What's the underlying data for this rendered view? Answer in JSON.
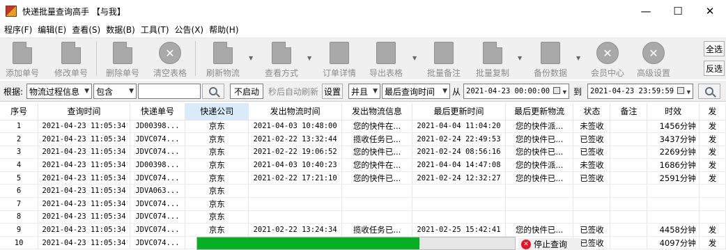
{
  "window": {
    "title": "快递批量查询高手 【与我】",
    "controls": {
      "minimize": "—",
      "maximize": "☐",
      "close": "✕"
    }
  },
  "menu": [
    "程序(F)",
    "编辑(E)",
    "查看(S)",
    "数据(B)",
    "工具(T)",
    "公告(X)",
    "帮助(H)"
  ],
  "toolbar": {
    "buttons": [
      {
        "label": "添加单号",
        "icon": "add-document-icon"
      },
      {
        "label": "修改单号",
        "icon": "edit-document-icon"
      },
      {
        "label": "删除单号",
        "icon": "delete-document-icon"
      },
      {
        "label": "清空表格",
        "icon": "clear-icon"
      },
      {
        "label": "刷新物流",
        "icon": "refresh-icon"
      },
      {
        "label": "查看方式",
        "icon": "view-mode-icon"
      },
      {
        "label": "订单详情",
        "icon": "order-detail-icon"
      },
      {
        "label": "导出表格",
        "icon": "export-icon"
      },
      {
        "label": "批量备注",
        "icon": "note-icon"
      },
      {
        "label": "批量复制",
        "icon": "copy-icon"
      },
      {
        "label": "备份数据",
        "icon": "backup-icon"
      },
      {
        "label": "会员中心",
        "icon": "clock-icon"
      },
      {
        "label": "高级设置",
        "icon": "gear-icon"
      }
    ],
    "select_all": "全选",
    "invert_select": "反选"
  },
  "filter": {
    "by_label": "根据:",
    "field": "物流过程信息",
    "operator": "包含",
    "keyword": "",
    "auto_refresh_toggle": "不启动",
    "auto_refresh_text": "秒后自动刷新",
    "settings": "设置",
    "logic": "并且",
    "time_field": "最后查询时间",
    "from_label": "从",
    "from_value": "2021-04-23 00:00:00",
    "to_label": "到",
    "to_value": "2021-04-23 23:59:59"
  },
  "table": {
    "columns": [
      "序号",
      "查询时间",
      "快递单号",
      "快递公司",
      "发出物流时间",
      "发出物流信息",
      "最后更新时间",
      "最后更新物流",
      "状态",
      "备注",
      "时效",
      "发"
    ],
    "rows": [
      [
        "1",
        "2021-04-23 11:05:34",
        "JD00398...",
        "京东",
        "2021-04-03 10:48:00",
        "您的快件在...",
        "2021-04-04 11:04:20",
        "您的快件派...",
        "未签收",
        "",
        "1456分钟",
        "发"
      ],
      [
        "2",
        "2021-04-23 11:05:34",
        "JDVC074...",
        "京东",
        "2021-02-22 13:32:44",
        "揽收任务已...",
        "2021-02-24 22:49:53",
        "您的快件已...",
        "已签收",
        "",
        "3437分钟",
        "发"
      ],
      [
        "3",
        "2021-04-23 11:05:34",
        "JDVC074...",
        "京东",
        "2021-02-22 19:06:52",
        "您的快件已...",
        "2021-02-24 08:56:16",
        "您的快件已...",
        "已签收",
        "",
        "2269分钟",
        "发"
      ],
      [
        "4",
        "2021-04-23 11:05:34",
        "JD00398...",
        "京东",
        "2021-04-03 10:40:23",
        "您的快件在...",
        "2021-04-04 14:47:08",
        "您的快件派...",
        "未签收",
        "",
        "1686分钟",
        "发"
      ],
      [
        "5",
        "2021-04-23 11:05:34",
        "JDVC074...",
        "京东",
        "2021-02-22 17:21:10",
        "您的快件已...",
        "2021-02-24 12:32:27",
        "您的快件已...",
        "已签收",
        "",
        "2591分钟",
        "发"
      ],
      [
        "6",
        "2021-04-23 11:05:34",
        "JDVA063...",
        "京东",
        "",
        "",
        "",
        "",
        "",
        "",
        "",
        ""
      ],
      [
        "7",
        "2021-04-23 11:05:34",
        "JDVC074...",
        "京东",
        "",
        "",
        "",
        "",
        "",
        "",
        "",
        ""
      ],
      [
        "8",
        "2021-04-23 11:05:34",
        "JDVC074...",
        "京东",
        "",
        "",
        "",
        "",
        "",
        "",
        "",
        ""
      ],
      [
        "9",
        "2021-04-23 11:05:34",
        "JDVC074...",
        "京东",
        "2021-02-22 13:24:34",
        "揽收任务已...",
        "2021-02-25 15:42:41",
        "您的快件已...",
        "已签收",
        "",
        "4458分钟",
        "发"
      ],
      [
        "10",
        "2021-04-23 11:05:34",
        "JDVC074...",
        "京东",
        "",
        "",
        "",
        "",
        "已签收",
        "",
        "4097分钟",
        "发"
      ]
    ]
  },
  "progress": {
    "fraction": 0.7,
    "stop_label": "停止查询",
    "color": "#06b025"
  }
}
